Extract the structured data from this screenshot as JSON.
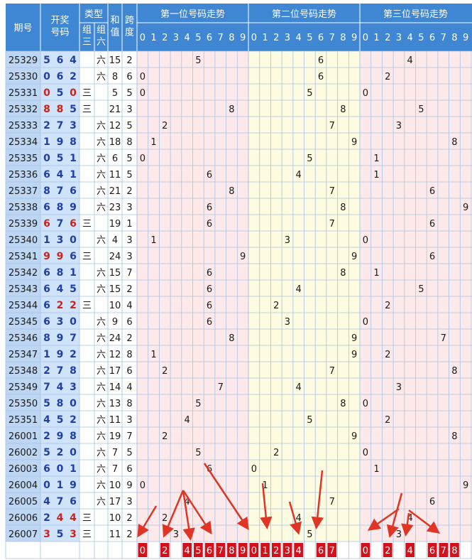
{
  "headers": {
    "period": "期号",
    "award": "开奖\n号码",
    "type": "类型",
    "zu_san": "组\n三",
    "zu_liu": "组\n六",
    "sum": "和\n值",
    "span": "跨\n度",
    "zones": [
      "第一位号码走势",
      "第二位号码走势",
      "第三位号码走势"
    ]
  },
  "digit_labels": [
    "0",
    "1",
    "2",
    "3",
    "4",
    "5",
    "6",
    "7",
    "8",
    "9"
  ],
  "type_labels": {
    "san": "三",
    "liu": "六"
  },
  "colors": {
    "period_bg": "#bcd6f3",
    "header_bg": "#3f86d3",
    "award_bg": "#cfe3fb",
    "zone1_bg": "#fde9e9",
    "zone2_bg": "#fdfbe0",
    "zone3_bg": "#fde9e9",
    "grid": "#a8c2e2",
    "digit_blue": "#1f3ea8",
    "digit_red": "#d0201a",
    "arrow_red": "#e03524",
    "box_red": "#d5101a"
  },
  "chart_data": {
    "type": "table",
    "rows": [
      {
        "period": "25329",
        "nums": [
          5,
          6,
          4
        ],
        "sum": 15,
        "span": 2
      },
      {
        "period": "25330",
        "nums": [
          0,
          6,
          2
        ],
        "sum": 8,
        "span": 6
      },
      {
        "period": "25331",
        "nums": [
          0,
          5,
          0
        ],
        "sum": 5,
        "span": 5
      },
      {
        "period": "25332",
        "nums": [
          8,
          8,
          5
        ],
        "sum": 21,
        "span": 3
      },
      {
        "period": "25333",
        "nums": [
          2,
          7,
          3
        ],
        "sum": 12,
        "span": 5
      },
      {
        "period": "25334",
        "nums": [
          1,
          9,
          8
        ],
        "sum": 18,
        "span": 8
      },
      {
        "period": "25335",
        "nums": [
          0,
          5,
          1
        ],
        "sum": 6,
        "span": 5
      },
      {
        "period": "25336",
        "nums": [
          6,
          4,
          1
        ],
        "sum": 11,
        "span": 5
      },
      {
        "period": "25337",
        "nums": [
          8,
          7,
          6
        ],
        "sum": 21,
        "span": 2
      },
      {
        "period": "25338",
        "nums": [
          6,
          8,
          9
        ],
        "sum": 23,
        "span": 3
      },
      {
        "period": "25339",
        "nums": [
          6,
          7,
          6
        ],
        "sum": 19,
        "span": 1
      },
      {
        "period": "25340",
        "nums": [
          1,
          3,
          0
        ],
        "sum": 4,
        "span": 3
      },
      {
        "period": "25341",
        "nums": [
          9,
          9,
          6
        ],
        "sum": 24,
        "span": 3
      },
      {
        "period": "25342",
        "nums": [
          6,
          8,
          1
        ],
        "sum": 15,
        "span": 7
      },
      {
        "period": "25343",
        "nums": [
          6,
          4,
          5
        ],
        "sum": 15,
        "span": 2
      },
      {
        "period": "25344",
        "nums": [
          6,
          2,
          2
        ],
        "sum": 10,
        "span": 4
      },
      {
        "period": "25345",
        "nums": [
          6,
          3,
          0
        ],
        "sum": 9,
        "span": 6
      },
      {
        "period": "25346",
        "nums": [
          8,
          9,
          7
        ],
        "sum": 24,
        "span": 2
      },
      {
        "period": "25347",
        "nums": [
          1,
          9,
          2
        ],
        "sum": 12,
        "span": 8
      },
      {
        "period": "25348",
        "nums": [
          2,
          7,
          8
        ],
        "sum": 17,
        "span": 6
      },
      {
        "period": "25349",
        "nums": [
          7,
          4,
          3
        ],
        "sum": 14,
        "span": 4
      },
      {
        "period": "25350",
        "nums": [
          5,
          8,
          0
        ],
        "sum": 13,
        "span": 8
      },
      {
        "period": "25351",
        "nums": [
          4,
          5,
          2
        ],
        "sum": 11,
        "span": 3
      },
      {
        "period": "26001",
        "nums": [
          2,
          9,
          8
        ],
        "sum": 19,
        "span": 7
      },
      {
        "period": "26002",
        "nums": [
          5,
          2,
          0
        ],
        "sum": 7,
        "span": 5
      },
      {
        "period": "26003",
        "nums": [
          6,
          0,
          1
        ],
        "sum": 7,
        "span": 6
      },
      {
        "period": "26004",
        "nums": [
          0,
          1,
          9
        ],
        "sum": 10,
        "span": 9
      },
      {
        "period": "26005",
        "nums": [
          4,
          7,
          6
        ],
        "sum": 17,
        "span": 3
      },
      {
        "period": "26006",
        "nums": [
          2,
          4,
          4
        ],
        "sum": 10,
        "span": 2
      },
      {
        "period": "26007",
        "nums": [
          3,
          5,
          3
        ],
        "sum": 11,
        "span": 2
      }
    ],
    "predictions": [
      [
        "0",
        "2",
        "4",
        "5",
        "6",
        "7",
        "8",
        "9"
      ],
      [
        "0",
        "1",
        "2",
        "3",
        "4",
        "6",
        "7"
      ],
      [
        "0",
        "2",
        "4",
        "6",
        "7",
        "8"
      ]
    ]
  }
}
